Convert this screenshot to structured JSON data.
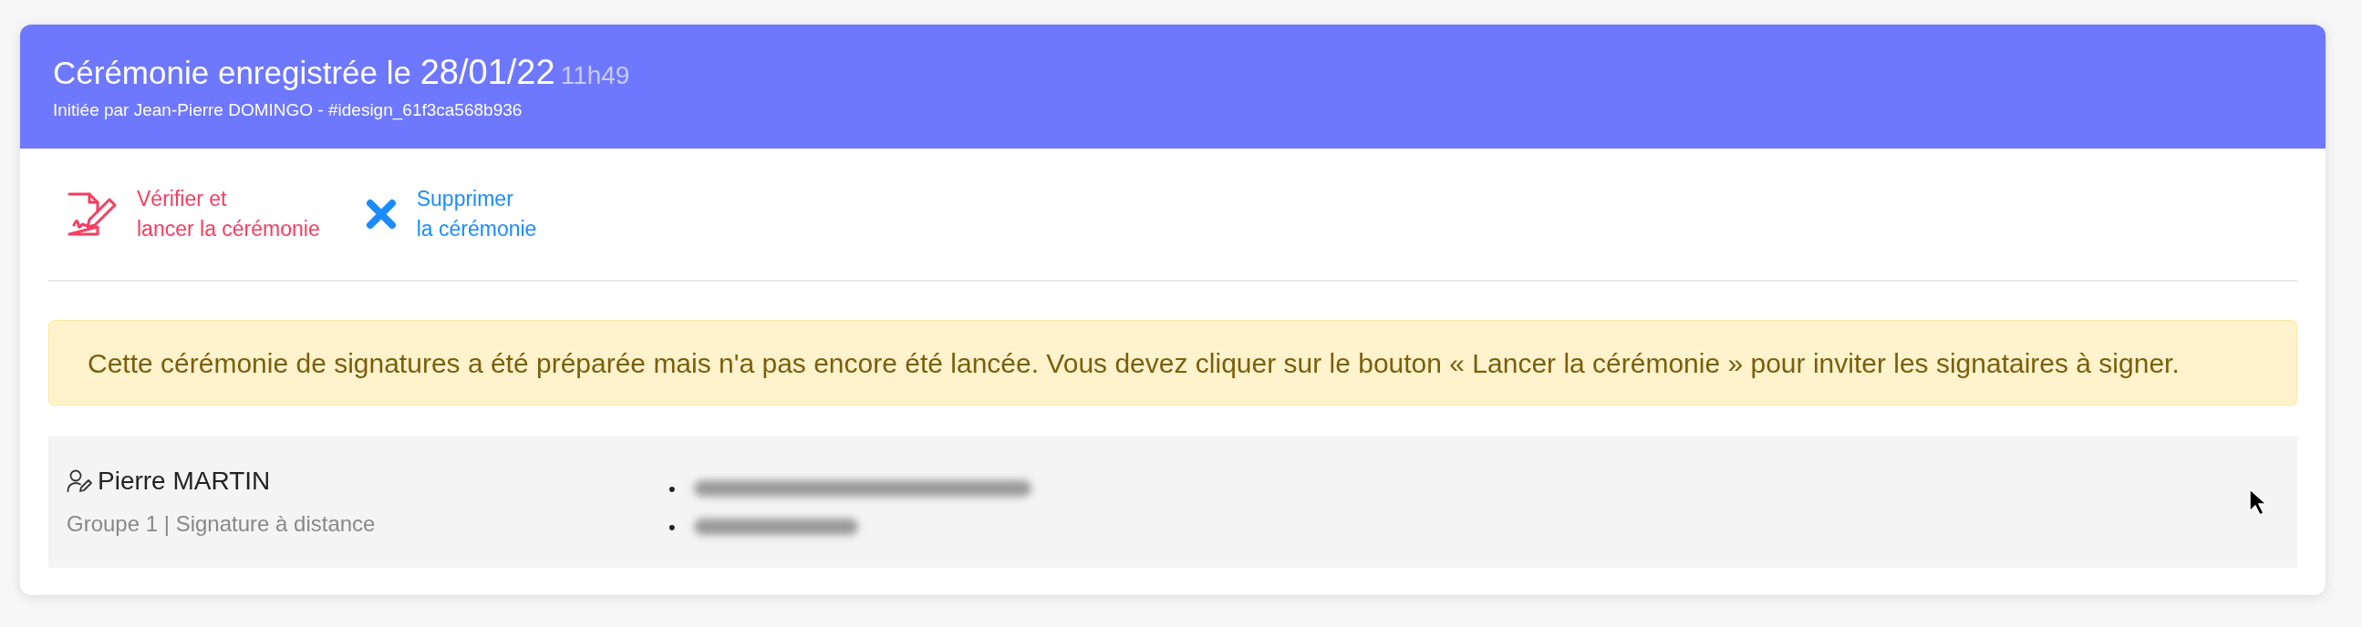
{
  "header": {
    "title": "Cérémonie enregistrée le",
    "date": "28/01/22",
    "time": "11h49",
    "subtitle": "Initiée par Jean-Pierre DOMINGO - #idesign_61f3ca568b936"
  },
  "actions": [
    {
      "kind": "verify",
      "lines": [
        "Vérifier et",
        "lancer la cérémonie"
      ]
    },
    {
      "kind": "delete",
      "lines": [
        "Supprimer",
        "la cérémonie"
      ]
    }
  ],
  "alert": {
    "text": "Cette cérémonie de signatures a été préparée mais n'a pas encore été lancée. Vous devez cliquer sur le bouton « Lancer la cérémonie » pour inviter les signataires à signer."
  },
  "signers": [
    {
      "name": "Pierre MARTIN",
      "details": "Groupe 1 | Signature à distance",
      "contacts": [
        {
          "kind": "email",
          "bullet": "•",
          "redacted": true
        },
        {
          "kind": "phone",
          "bullet": "•",
          "redacted": true
        }
      ]
    }
  ]
}
